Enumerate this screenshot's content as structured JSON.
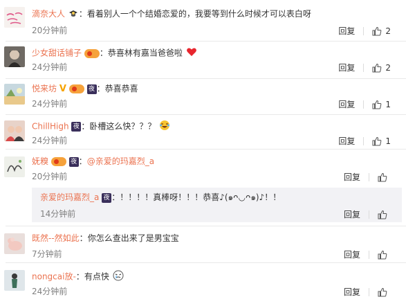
{
  "comments": [
    {
      "user": "滴奈大人",
      "sep": "：",
      "text": "看着别人一个个结婚恋爱的，我要等到什么时候才可以表白呀",
      "time": "20分钟前",
      "reply": "回复",
      "likes": "2"
    },
    {
      "user": "少女甜话铺子",
      "sep": "：",
      "text": "恭喜林有嘉当爸爸啦",
      "time": "24分钟前",
      "reply": "回复",
      "likes": "2"
    },
    {
      "user": "悦来坊",
      "sep": "：",
      "text": "恭喜恭喜",
      "time": "24分钟前",
      "reply": "回复",
      "likes": "1"
    },
    {
      "user": "ChillHigh",
      "sep": "：",
      "text": "卧槽这么快？？？",
      "time": "24分钟前",
      "reply": "回复",
      "likes": "1"
    },
    {
      "user": "妩糗",
      "sep": "：",
      "text": "@亲爱的玛嘉烈_a",
      "time": "20分钟前",
      "reply": "回复",
      "likes": ""
    },
    {
      "user": "既然--然如此",
      "sep": "：",
      "text": "你怎么查出来了是男宝宝",
      "time": "7分钟前",
      "reply": "回复",
      "likes": ""
    },
    {
      "user": "nongcai放-",
      "sep": "：",
      "text": "有点快",
      "time": "24分钟前",
      "reply": "回复",
      "likes": ""
    }
  ],
  "sub_reply": {
    "user": "亲爱的玛嘉烈_a",
    "sep": "：",
    "text": "！！！！真棒呀！！！恭喜♪(๑ᴖ◡ᴖ๑)♪！！",
    "time": "14分钟前",
    "reply": "回复",
    "likes": ""
  },
  "colors": {
    "username": "#eb7350",
    "text": "#333333",
    "time": "#808080",
    "divider": "#e9e9e9",
    "subbg": "#f2f2f5"
  }
}
